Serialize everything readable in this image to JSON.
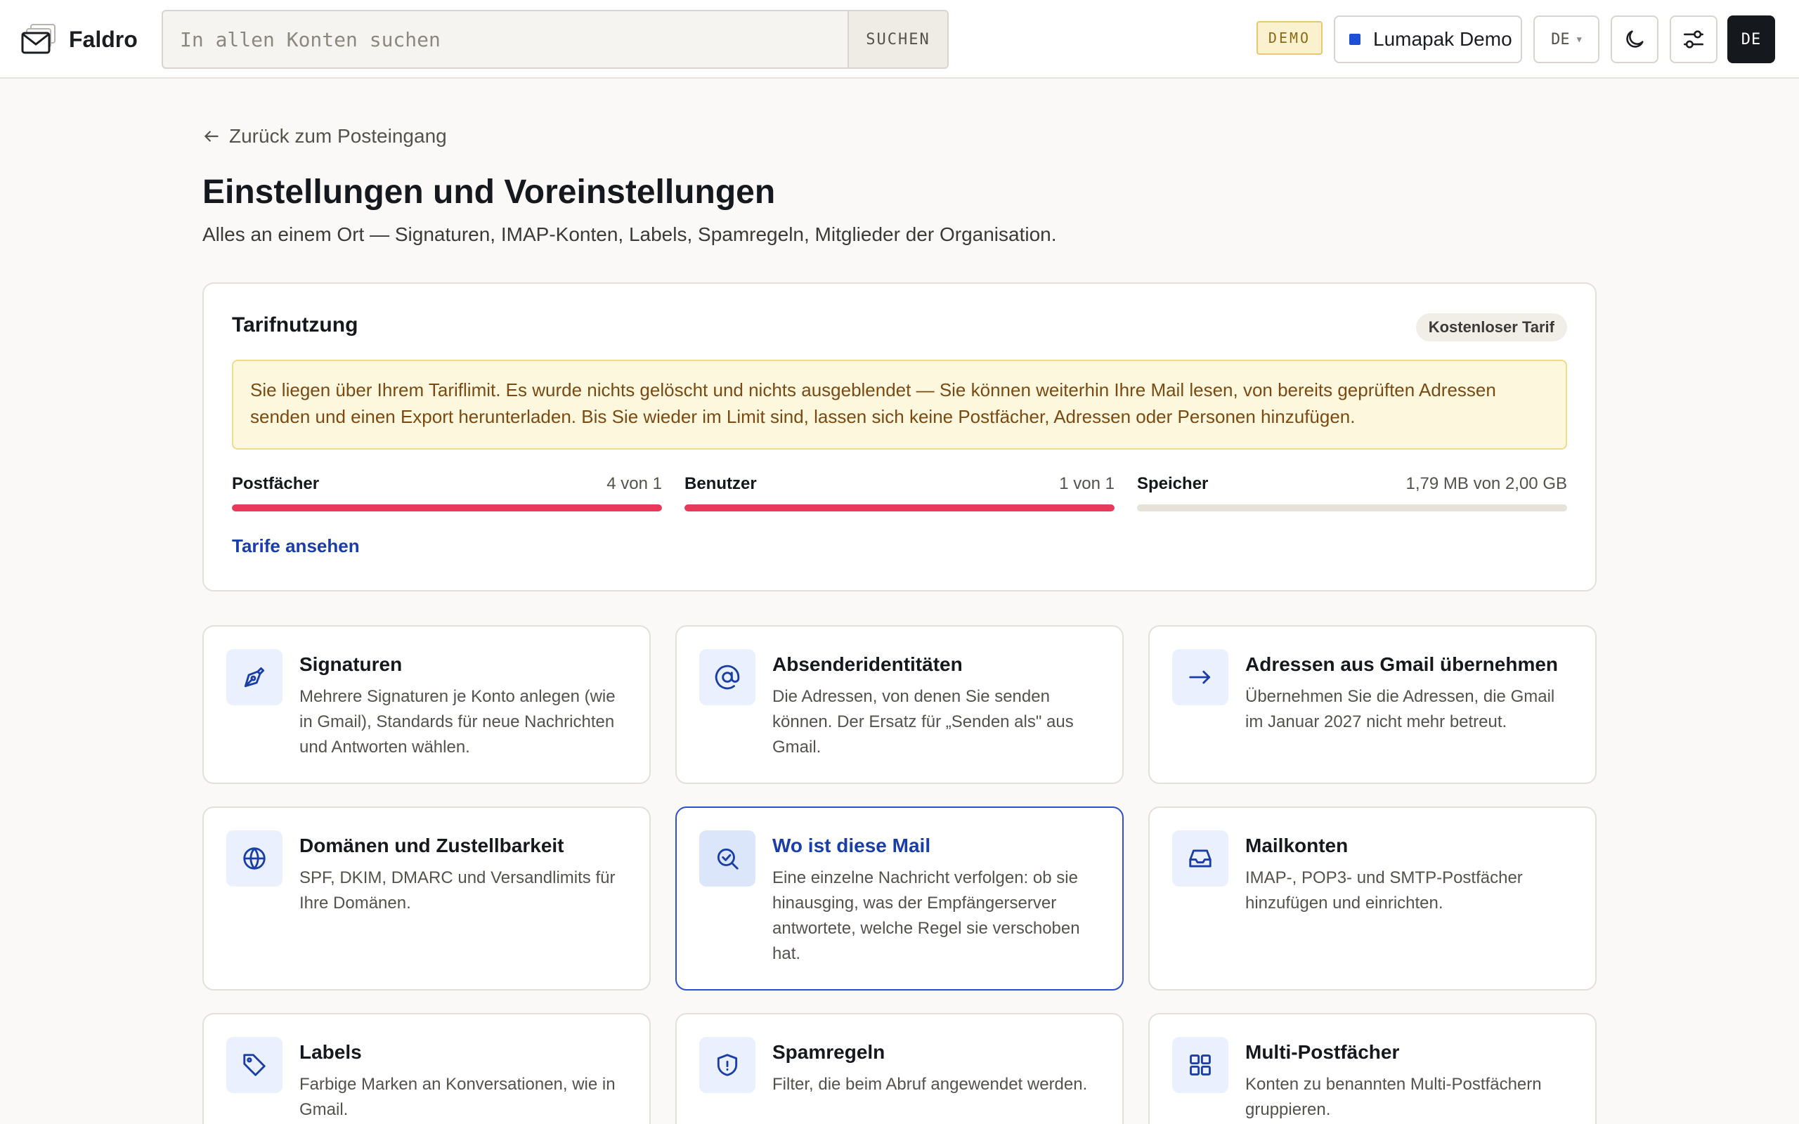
{
  "header": {
    "brand": "Faldro",
    "search_placeholder": "In allen Konten suchen",
    "search_button": "SUCHEN",
    "demo_badge": "DEMO",
    "account_name": "Lumapak Demo",
    "language": "DE",
    "avatar_initials": "DE",
    "colors": {
      "account_dot": "#1f4fd6",
      "avatar_bg": "#15181d"
    }
  },
  "page": {
    "back_link": "Zurück zum Posteingang",
    "title": "Einstellungen und Voreinstellungen",
    "subtitle": "Alles an einem Ort — Signaturen, IMAP-Konten, Labels, Spamregeln, Mitglieder der Organisation."
  },
  "usage": {
    "title": "Tarifnutzung",
    "plan_badge": "Kostenloser Tarif",
    "warning": "Sie liegen über Ihrem Tariflimit. Es wurde nichts gelöscht und nichts ausgeblendet — Sie können weiterhin Ihre Mail lesen, von bereits geprüften Adressen senden und einen Export herunterladen. Bis Sie wieder im Limit sind, lassen sich keine Postfächer, Adressen oder Personen hinzufügen.",
    "meters": [
      {
        "label": "Postfächer",
        "value": "4 von 1",
        "fill_percent": 100,
        "color": "#e8395a"
      },
      {
        "label": "Benutzer",
        "value": "1 von 1",
        "fill_percent": 100,
        "color": "#e8395a"
      },
      {
        "label": "Speicher",
        "value": "1,79 MB von 2,00 GB",
        "fill_percent": 0,
        "color": "#e6e2d8"
      }
    ],
    "plans_link": "Tarife ansehen"
  },
  "tiles": [
    {
      "icon": "pen-nib-icon",
      "title": "Signaturen",
      "desc": "Mehrere Signaturen je Konto anlegen (wie in Gmail), Standards für neue Nachrichten und Antworten wählen."
    },
    {
      "icon": "at-sign-icon",
      "title": "Absenderidentitäten",
      "desc": "Die Adressen, von denen Sie senden können. Der Ersatz für „Senden als\" aus Gmail."
    },
    {
      "icon": "arrow-right-icon",
      "title": "Adressen aus Gmail übernehmen",
      "desc": "Übernehmen Sie die Adressen, die Gmail im Januar 2027 nicht mehr betreut."
    },
    {
      "icon": "globe-icon",
      "title": "Domänen und Zustellbarkeit",
      "desc": "SPF, DKIM, DMARC und Versandlimits für Ihre Domänen."
    },
    {
      "icon": "search-check-icon",
      "title": "Wo ist diese Mail",
      "desc": "Eine einzelne Nachricht verfolgen: ob sie hinausging, was der Empfängerserver antwortete, welche Regel sie verschoben hat."
    },
    {
      "icon": "inbox-icon",
      "title": "Mailkonten",
      "desc": "IMAP-, POP3- und SMTP-Postfächer hinzufügen und einrichten."
    },
    {
      "icon": "tag-icon",
      "title": "Labels",
      "desc": "Farbige Marken an Konversationen, wie in Gmail."
    },
    {
      "icon": "shield-icon",
      "title": "Spamregeln",
      "desc": "Filter, die beim Abruf angewendet werden."
    },
    {
      "icon": "grid-icon",
      "title": "Multi-Postfächer",
      "desc": "Konten zu benannten Multi-Postfächern gruppieren."
    }
  ]
}
